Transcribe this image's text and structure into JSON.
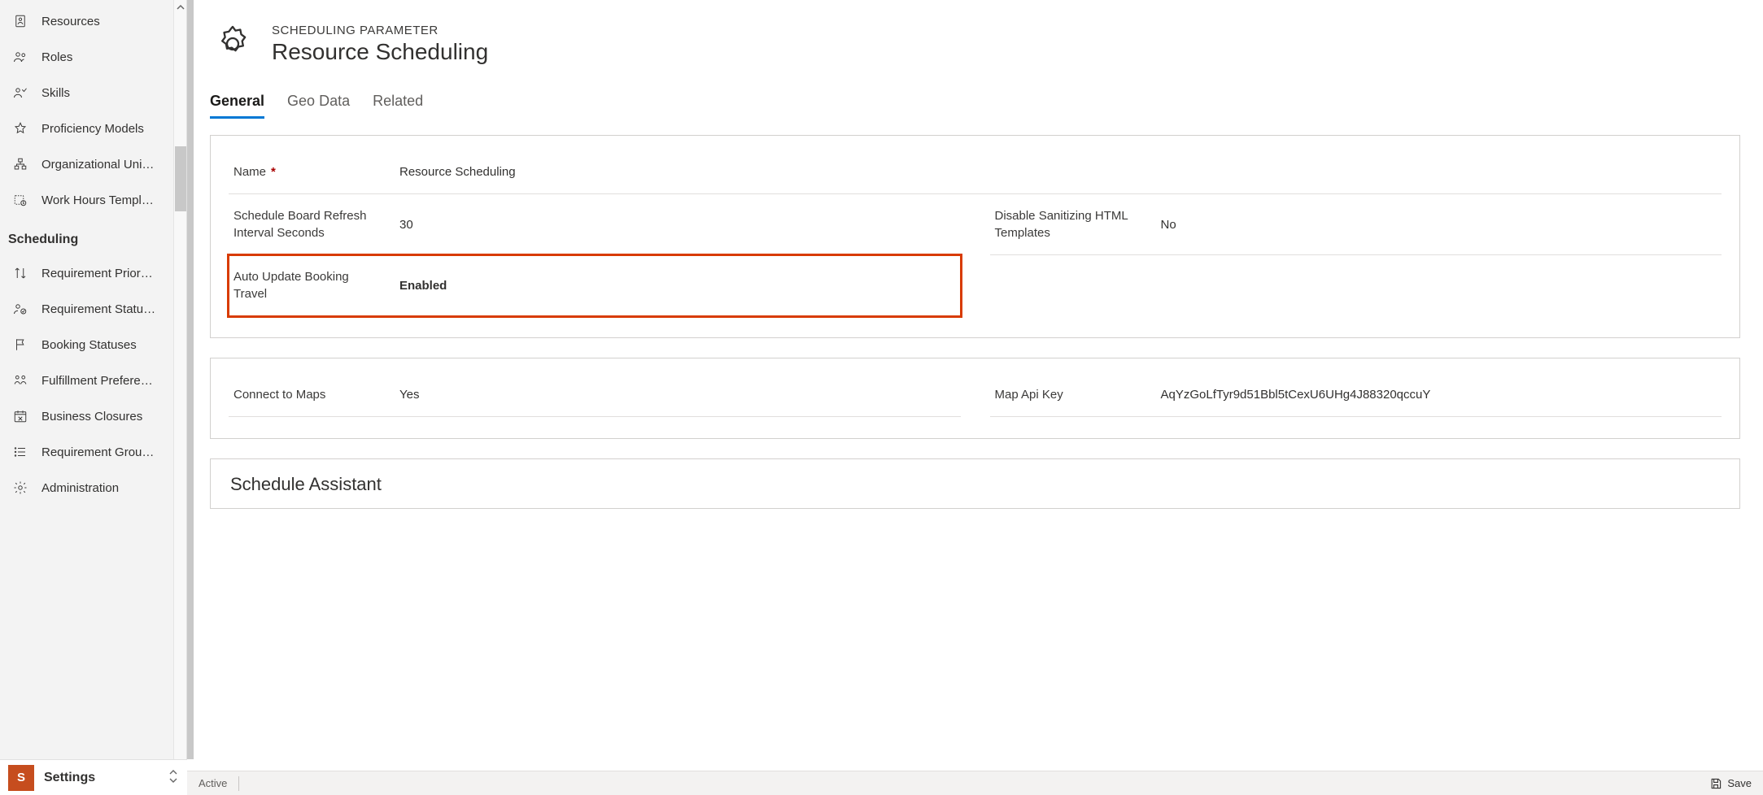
{
  "sidebar": {
    "items_top": [
      {
        "key": "resources",
        "label": "Resources"
      },
      {
        "key": "roles",
        "label": "Roles"
      },
      {
        "key": "skills",
        "label": "Skills"
      },
      {
        "key": "proficiency",
        "label": "Proficiency Models"
      },
      {
        "key": "orgunits",
        "label": "Organizational Uni…"
      },
      {
        "key": "workhours",
        "label": "Work Hours Templ…"
      }
    ],
    "section_header": "Scheduling",
    "items_bottom": [
      {
        "key": "reqprior",
        "label": "Requirement Prior…"
      },
      {
        "key": "reqstatus",
        "label": "Requirement Statu…"
      },
      {
        "key": "bookingstatus",
        "label": "Booking Statuses"
      },
      {
        "key": "fulfillment",
        "label": "Fulfillment Prefere…"
      },
      {
        "key": "bizclosures",
        "label": "Business Closures"
      },
      {
        "key": "reqgroup",
        "label": "Requirement Grou…"
      },
      {
        "key": "admin",
        "label": "Administration"
      }
    ]
  },
  "app_switcher": {
    "tile_letter": "S",
    "name": "Settings"
  },
  "header": {
    "overline": "SCHEDULING PARAMETER",
    "title": "Resource Scheduling"
  },
  "tabs": [
    {
      "key": "general",
      "label": "General",
      "active": true
    },
    {
      "key": "geodata",
      "label": "Geo Data",
      "active": false
    },
    {
      "key": "related",
      "label": "Related",
      "active": false
    }
  ],
  "form": {
    "name": {
      "label": "Name",
      "value": "Resource Scheduling",
      "required": true
    },
    "refresh_interval": {
      "label": "Schedule Board Refresh Interval Seconds",
      "value": "30"
    },
    "disable_sanitize": {
      "label": "Disable Sanitizing HTML Templates",
      "value": "No"
    },
    "auto_update_travel": {
      "label": "Auto Update Booking Travel",
      "value": "Enabled"
    },
    "connect_maps": {
      "label": "Connect to Maps",
      "value": "Yes"
    },
    "map_api_key": {
      "label": "Map Api Key",
      "value": "AqYzGoLfTyr9d51Bbl5tCexU6UHg4J88320qccuY"
    },
    "section_assistant_title": "Schedule Assistant"
  },
  "statusbar": {
    "state": "Active",
    "save": "Save"
  },
  "required_marker": "*"
}
